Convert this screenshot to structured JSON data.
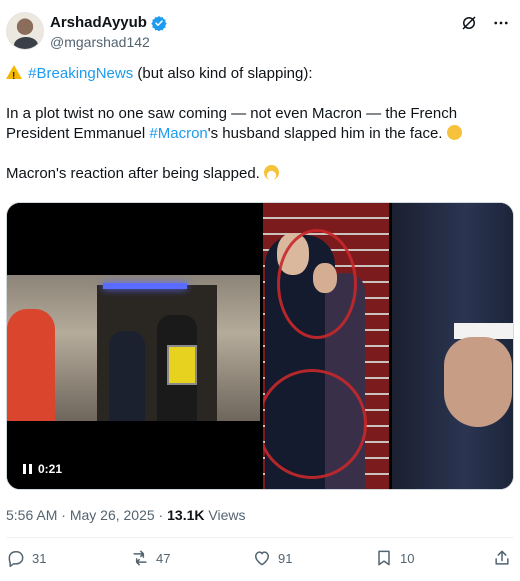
{
  "author": {
    "display_name": "ArshadAyyub",
    "handle": "@mgarshad142"
  },
  "tweet": {
    "line1_prefix": "#BreakingNews",
    "line1_suffix": " (but also kind of slapping):",
    "para2_part1": "In a plot twist no one saw coming — not even Macron — the French President Emmanuel ",
    "para2_hashtag": "#Macron",
    "para2_part2": "'s husband slapped him in the face. ",
    "para3": "Macron's reaction after being slapped. "
  },
  "media": {
    "video_duration": "0:21"
  },
  "meta": {
    "time": "5:56 AM",
    "separator1": " · ",
    "date": "May 26, 2025",
    "separator2": " · ",
    "views_count": "13.1K",
    "views_label": " Views"
  },
  "actions": {
    "replies": "31",
    "reposts": "47",
    "likes": "91",
    "bookmarks": "10"
  },
  "colors": {
    "accent": "#1d9bf0",
    "text": "#0f1419",
    "secondary": "#536471"
  },
  "icons": [
    "verified-badge-icon",
    "grok-icon",
    "more-icon",
    "warning-icon",
    "shushing-face-icon",
    "face-with-mask-icon",
    "reply-icon",
    "repost-icon",
    "like-icon",
    "bookmark-icon",
    "share-icon",
    "pause-icon"
  ]
}
